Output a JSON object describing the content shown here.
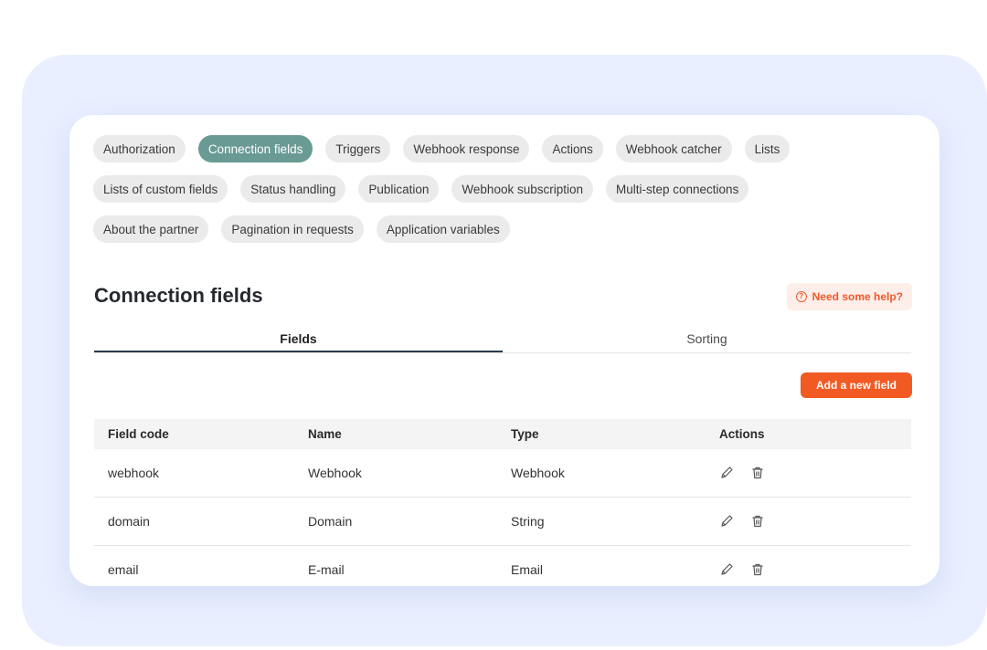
{
  "chips": [
    [
      "Authorization",
      "Connection fields",
      "Triggers",
      "Webhook response",
      "Actions",
      "Webhook catcher",
      "Lists"
    ],
    [
      "Lists of custom fields",
      "Status handling",
      "Publication",
      "Webhook subscription",
      "Multi-step connections"
    ],
    [
      "About the partner",
      "Pagination in requests",
      "Application variables"
    ]
  ],
  "active_chip": "Connection fields",
  "page_title": "Connection fields",
  "help_label": "Need some help?",
  "tabs": {
    "fields": "Fields",
    "sorting": "Sorting"
  },
  "add_button_label": "Add a new field",
  "table": {
    "headers": {
      "code": "Field code",
      "name": "Name",
      "type": "Type",
      "actions": "Actions"
    },
    "rows": [
      {
        "code": "webhook",
        "name": "Webhook",
        "type": "Webhook"
      },
      {
        "code": "domain",
        "name": "Domain",
        "type": "String"
      },
      {
        "code": "email",
        "name": "E-mail",
        "type": "Email"
      }
    ]
  },
  "icons": {
    "edit": "pencil-icon",
    "delete": "trash-icon",
    "help": "question-circle-icon"
  },
  "colors": {
    "accent": "#f25a24",
    "active_chip": "#6a9a94",
    "backdrop": "#e9efff"
  }
}
